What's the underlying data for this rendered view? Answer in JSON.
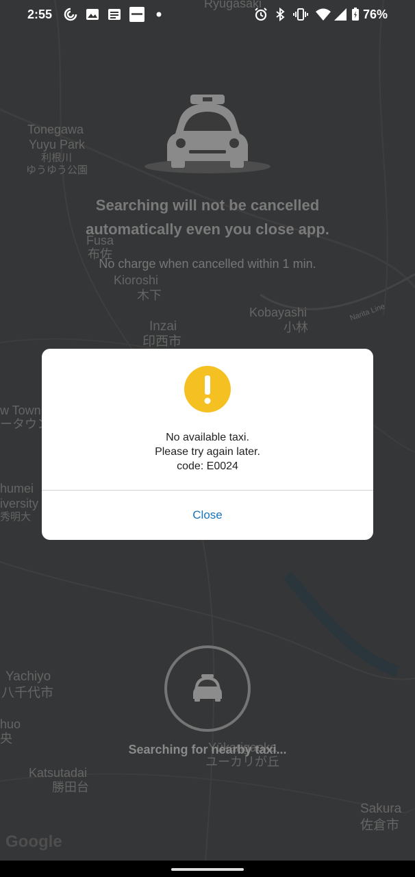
{
  "status_bar": {
    "time": "2:55",
    "battery_percent": "76%",
    "left_icons": [
      "data-saver-icon",
      "image-icon",
      "notes-icon",
      "app-icon",
      "dot-icon"
    ],
    "right_icons": [
      "alarm-icon",
      "bluetooth-icon",
      "vibrate-icon",
      "wifi-icon",
      "signal-icon",
      "battery-icon"
    ]
  },
  "map": {
    "labels": [
      {
        "id": "ryugasaki",
        "text": "Ryugasaki"
      },
      {
        "id": "tonegawa",
        "text": "Tonegawa"
      },
      {
        "id": "yuyu-park",
        "text": "Yuyu Park"
      },
      {
        "id": "tonegawa-jp",
        "text": "利根川"
      },
      {
        "id": "yuyu-jp",
        "text": "ゆうゆう公園"
      },
      {
        "id": "fusa",
        "text": "Fusa"
      },
      {
        "id": "fusa-jp",
        "text": "布佐"
      },
      {
        "id": "kioroshi",
        "text": "Kioroshi"
      },
      {
        "id": "kioroshi-jp",
        "text": "木下"
      },
      {
        "id": "kobayashi",
        "text": "Kobayashi"
      },
      {
        "id": "kobayashi-jp",
        "text": "小林"
      },
      {
        "id": "inzai",
        "text": "Inzai"
      },
      {
        "id": "inzai-jp",
        "text": "印西市"
      },
      {
        "id": "new-town",
        "text": "w Town"
      },
      {
        "id": "new-town-jp",
        "text": "ータウン"
      },
      {
        "id": "shumei",
        "text": "humei"
      },
      {
        "id": "university",
        "text": "iversity"
      },
      {
        "id": "shumei-jp",
        "text": "秀明大"
      },
      {
        "id": "yachiyo",
        "text": "Yachiyo"
      },
      {
        "id": "yachiyo-jp",
        "text": "八千代市"
      },
      {
        "id": "chuo",
        "text": "huo"
      },
      {
        "id": "chuo-jp",
        "text": "央"
      },
      {
        "id": "yukarigaoka",
        "text": "Yūkarigaoka"
      },
      {
        "id": "yukarigaoka-jp",
        "text": "ユーカリが丘"
      },
      {
        "id": "katsutadai",
        "text": "Katsutadai"
      },
      {
        "id": "katsutadai-jp",
        "text": "勝田台"
      },
      {
        "id": "sakura",
        "text": "Sakura"
      },
      {
        "id": "sakura-jp",
        "text": "佐倉市"
      },
      {
        "id": "narita-line",
        "text": "Narita Line"
      }
    ],
    "attribution": "Google"
  },
  "search_screen": {
    "headline_line1": "Searching will not be cancelled",
    "headline_line2": "automatically even you close app.",
    "subline": "No charge when cancelled within 1 min.",
    "searching_text": "Searching for nearby taxi..."
  },
  "dialog": {
    "icon": "warning-icon",
    "message_lines": [
      "No available taxi.",
      "Please try again later.",
      "code: E0024"
    ],
    "close_label": "Close"
  },
  "colors": {
    "accent_blue": "#1a73b8",
    "warning_yellow": "#f5c021",
    "map_background": "#3a3b3c"
  }
}
